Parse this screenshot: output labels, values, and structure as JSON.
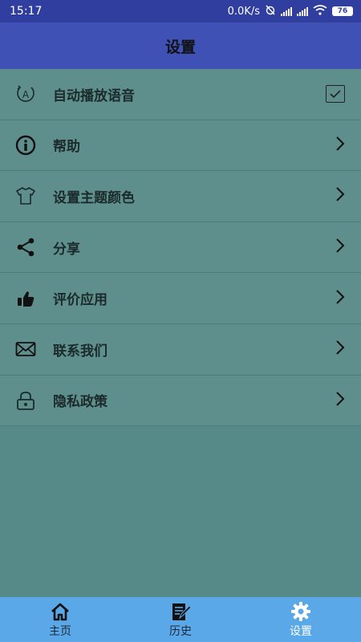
{
  "status_bar": {
    "time": "15:17",
    "net_speed": "0.0K/s",
    "battery": "76"
  },
  "header": {
    "title": "设置"
  },
  "settings": {
    "items": [
      {
        "label": "自动播放语音",
        "icon": "auto-play-icon",
        "control": "checkbox",
        "checked": true
      },
      {
        "label": "帮助",
        "icon": "info-icon",
        "control": "chevron"
      },
      {
        "label": "设置主题颜色",
        "icon": "tshirt-icon",
        "control": "chevron"
      },
      {
        "label": "分享",
        "icon": "share-icon",
        "control": "chevron"
      },
      {
        "label": "评价应用",
        "icon": "thumbs-up-icon",
        "control": "chevron"
      },
      {
        "label": "联系我们",
        "icon": "envelope-icon",
        "control": "chevron"
      },
      {
        "label": "隐私政策",
        "icon": "lock-icon",
        "control": "chevron"
      }
    ]
  },
  "bottom_nav": {
    "items": [
      {
        "label": "主页",
        "icon": "home-icon"
      },
      {
        "label": "历史",
        "icon": "history-icon"
      },
      {
        "label": "设置",
        "icon": "gear-icon",
        "active": true
      }
    ]
  },
  "colors": {
    "status_bar": "#303f9f",
    "app_bar": "#3f51b5",
    "list_background": "#5f8f8d",
    "page_background": "#568a88",
    "bottom_nav": "#5aa8e8"
  }
}
